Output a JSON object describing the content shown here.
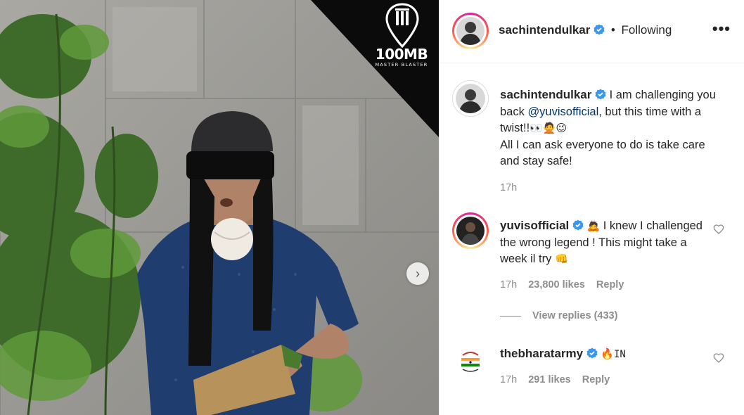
{
  "media": {
    "brand_name": "100MB",
    "brand_sub": "MASTER BLASTER",
    "next_icon": "chevron-right-icon",
    "next_glyph": "›"
  },
  "header": {
    "username": "sachintendulkar",
    "separator": "•",
    "follow_status": "Following",
    "more_glyph": "•••"
  },
  "caption": {
    "username": "sachintendulkar",
    "text_before": "I am challenging you back ",
    "mention": "@yuvisofficial",
    "text_after": ", but this time with a twist!!",
    "emojis": "👀🙅😉",
    "text_line2": "All I can ask everyone to do is take care and stay safe!",
    "time": "17h"
  },
  "comments": [
    {
      "username": "yuvisofficial",
      "emoji_lead": "🙇",
      "text": " I knew I challenged the wrong legend ! This might take a week il try ",
      "emoji_tail": "👊",
      "time": "17h",
      "likes": "23,800 likes",
      "reply": "Reply"
    },
    {
      "username": "thebharatarmy",
      "emoji_lead": "🔥",
      "text": "IN",
      "emoji_tail": "",
      "time": "17h",
      "likes": "291 likes",
      "reply": "Reply"
    }
  ],
  "view_replies": "View replies (433)",
  "colors": {
    "verified": "#3897f0",
    "meta_gray": "#8e8e8e",
    "mention": "#00376b"
  }
}
